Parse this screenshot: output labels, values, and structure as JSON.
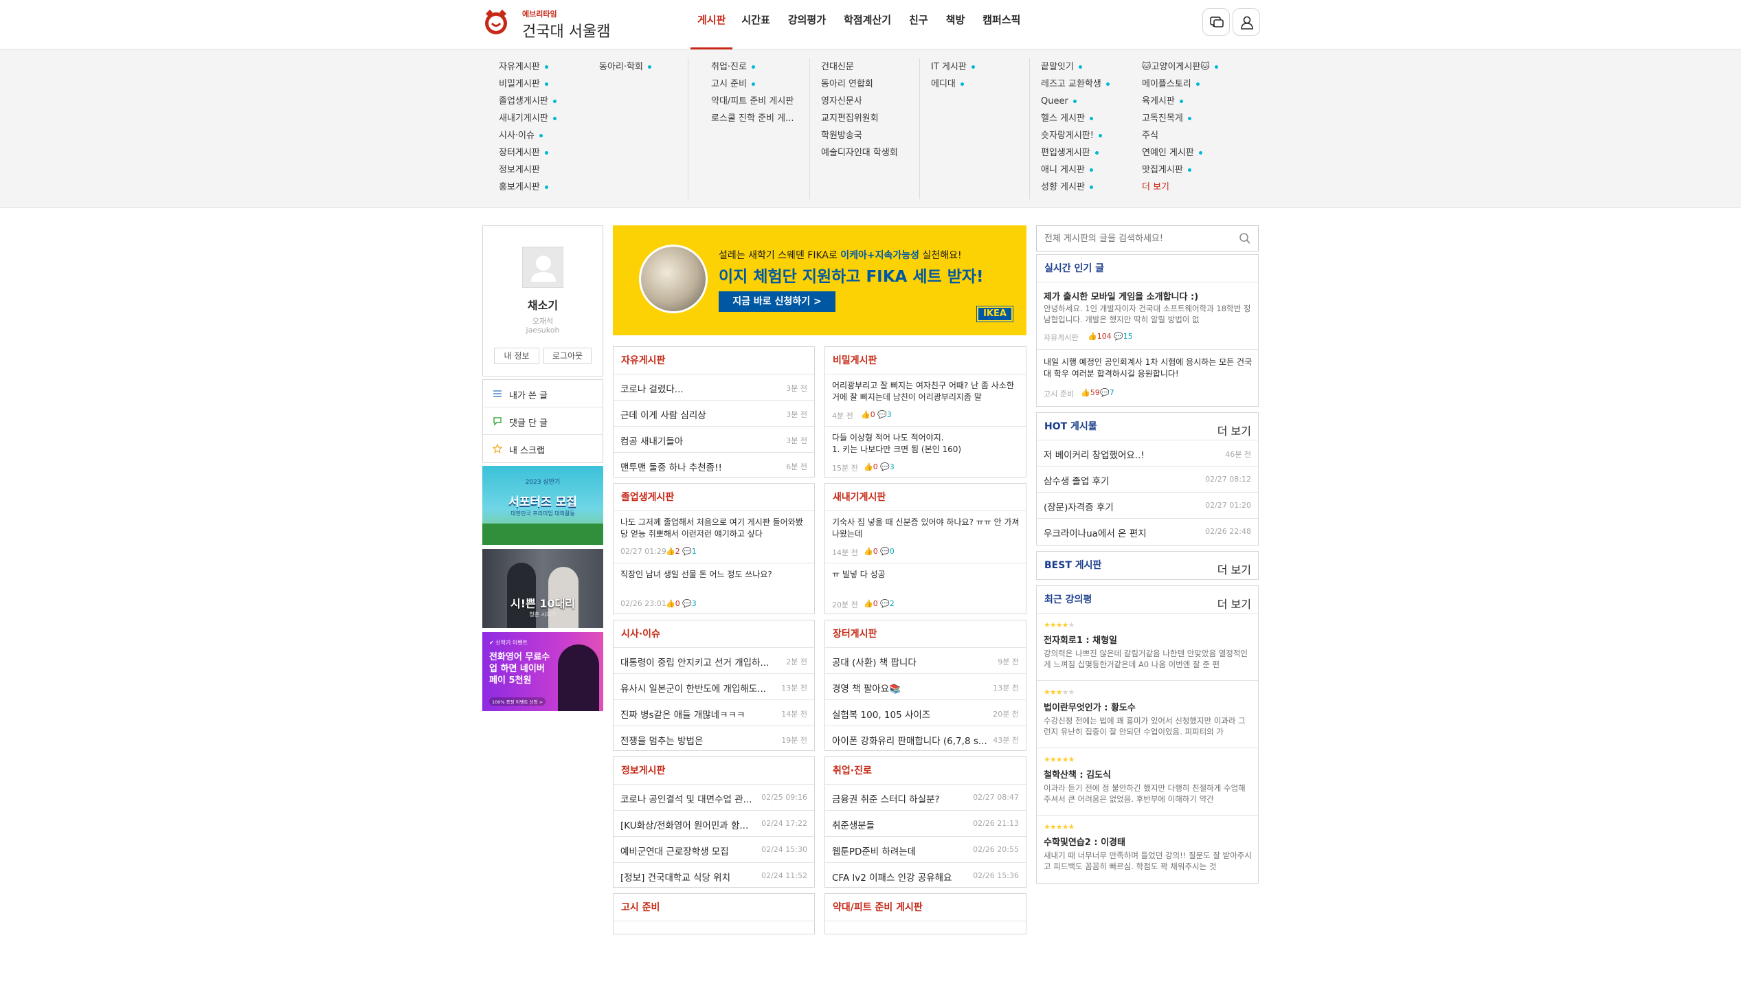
{
  "brand": {
    "sub": "에브리타임",
    "name": "건국대 서울캠"
  },
  "nav": [
    {
      "label": "게시판",
      "active": true
    },
    {
      "label": "시간표"
    },
    {
      "label": "강의평가"
    },
    {
      "label": "학점계산기"
    },
    {
      "label": "친구"
    },
    {
      "label": "책방"
    },
    {
      "label": "캠퍼스픽"
    }
  ],
  "megamenu": {
    "columns": [
      {
        "items": [
          {
            "label": "자유게시판",
            "dot": true
          },
          {
            "label": "비밀게시판",
            "dot": true
          },
          {
            "label": "졸업생게시판",
            "dot": true
          },
          {
            "label": "새내기게시판",
            "dot": true
          },
          {
            "label": "시사·이슈",
            "dot": true
          },
          {
            "label": "장터게시판",
            "dot": true
          },
          {
            "label": "정보게시판"
          },
          {
            "label": "홍보게시판",
            "dot": true
          }
        ]
      },
      {
        "items": [
          {
            "label": "동아리·학회",
            "dot": true
          }
        ]
      },
      {
        "items": [
          {
            "label": "취업·진로",
            "dot": true
          },
          {
            "label": "고시 준비",
            "dot": true
          },
          {
            "label": "약대/피트 준비 게시판"
          },
          {
            "label": "로스쿨 진학 준비 게..."
          }
        ]
      },
      {
        "items": [
          {
            "label": "건대신문"
          },
          {
            "label": "동아리 연합회"
          },
          {
            "label": "영자신문사"
          },
          {
            "label": "교지편집위원회"
          },
          {
            "label": "학원방송국"
          },
          {
            "label": "예술디자인대 학생회"
          }
        ]
      },
      {
        "items": [
          {
            "label": "IT 게시판",
            "dot": true
          },
          {
            "label": "에디대",
            "dot": true
          }
        ]
      },
      {
        "items": [
          {
            "label": "끝말잇기",
            "dot": true
          },
          {
            "label": "레즈고 교환학생",
            "dot": true
          },
          {
            "label": "Queer",
            "dot": true
          },
          {
            "label": "헬스 게시판",
            "dot": true
          },
          {
            "label": "숏자랑게시판!",
            "dot": true
          },
          {
            "label": "편입생게시판",
            "dot": true
          },
          {
            "label": "애니 게시판",
            "dot": true
          },
          {
            "label": "성향 게시판",
            "dot": true
          }
        ]
      },
      {
        "items": [
          {
            "label": "🐱고양이게시판🐱",
            "dot": true
          },
          {
            "label": "메이플스토리",
            "dot": true
          },
          {
            "label": "육게시판",
            "dot": true
          },
          {
            "label": "고독진목게",
            "dot": true
          },
          {
            "label": "주식"
          },
          {
            "label": "연예인 게시판",
            "dot": true
          },
          {
            "label": "맛집게시판",
            "dot": true
          },
          {
            "label": "더 보기",
            "more": true
          }
        ]
      }
    ]
  },
  "profile": {
    "name": "채소기",
    "realname": "오재석",
    "userid": "jaesukoh",
    "btn_info": "내 정보",
    "btn_logout": "로그아웃",
    "menu": [
      {
        "label": "내가 쓴 글",
        "icon": "list-icon"
      },
      {
        "label": "댓글 단 글",
        "icon": "comment-icon"
      },
      {
        "label": "내 스크랩",
        "icon": "star-icon"
      }
    ]
  },
  "side_ads": [
    {
      "badge": "2023 상반기",
      "title": "서포터즈 모집",
      "tail": "대한민국 프리미엄 대외활동"
    },
    {
      "title": "시!쁜 10대리",
      "tail": "청춘 시리즈"
    },
    {
      "badge": "✔ 신학기 이벤트",
      "title": "전화영어 무료수업 하면 네이버페이 5천원",
      "tail": "100% 증정 이벤트 신청 >"
    }
  ],
  "banner": {
    "line1_prefix": "설레는 새학기 스웨덴 FIKA로 ",
    "line1_hl": "이케아+지속가능성",
    "line1_suffix": " 실천해요!",
    "line2": "이지 체험단 지원하고 FIKA 세트 받자!",
    "cta": "지금 바로 신청하기 >",
    "logo": "IKEA"
  },
  "boards": [
    {
      "title": "자유게시판",
      "type": "list",
      "posts": [
        {
          "title": "코로나 걸렸다...",
          "time": "3분 전"
        },
        {
          "title": "근데 이게 사람 심리상",
          "time": "3분 전"
        },
        {
          "title": "컴공 새내기들아",
          "time": "3분 전"
        },
        {
          "title": "맨투맨 둘중 하나 추천좀!!",
          "time": "6분 전"
        }
      ]
    },
    {
      "title": "비밀게시판",
      "type": "preview",
      "posts": [
        {
          "body": "어리광부리고 잘 삐지는 여자친구 어때? 난 좀 사소한거에 잘 삐지는데 남친이 어리광부리지좀 말",
          "time": "4분 전",
          "votes": "0",
          "comments": "3"
        },
        {
          "body": "다들 이상형 적어 나도 적어야지.\n1. 키는 나보다만 크면 됨 (본인 160)",
          "time": "15분 전",
          "votes": "0",
          "comments": "3"
        }
      ]
    },
    {
      "title": "졸업생게시판",
      "type": "preview",
      "posts": [
        {
          "body": "나도 그저께 졸업해서 처음으로 여기 게시판 들어와봤당 얻능 취뽀해서 이런저런 얘기하고 싶다",
          "time": "02/27 01:29",
          "votes": "2",
          "comments": "1"
        },
        {
          "body": "직장인 남녀 생일 선물 돈 어느 정도 쓰나요?",
          "time": "02/26 23:01",
          "votes": "0",
          "comments": "3"
        }
      ]
    },
    {
      "title": "새내기게시판",
      "type": "preview",
      "posts": [
        {
          "body": "기숙사 짐 넣을 때 신분증 있어야 하나요? ㅠㅠ 안 가져 나왔는데",
          "time": "14분 전",
          "votes": "0",
          "comments": "0"
        },
        {
          "body": "ㅠ 빌넣 다 성공",
          "time": "20분 전",
          "votes": "0",
          "comments": "2"
        }
      ]
    },
    {
      "title": "시사·이슈",
      "type": "list",
      "posts": [
        {
          "title": "대통령이 중립 안지키고 선거 개입하...",
          "time": "2분 전"
        },
        {
          "title": "유사시 일본군이 한반도에 개입해도...",
          "time": "13분 전"
        },
        {
          "title": "진짜 병s같은 애들 개많네ㅋㅋㅋ",
          "time": "14분 전"
        },
        {
          "title": "전쟁을 멈추는 방법은",
          "time": "19분 전"
        }
      ]
    },
    {
      "title": "장터게시판",
      "type": "list",
      "posts": [
        {
          "title": "공대 (사환) 책 팝니다",
          "time": "9분 전"
        },
        {
          "title": "경영 책 팔아요📚",
          "time": "13분 전"
        },
        {
          "title": "실험복 100, 105 사이즈",
          "time": "20분 전"
        },
        {
          "title": "아이폰 강화유리 판매합니다 (6,7,8 s...",
          "time": "43분 전"
        }
      ]
    },
    {
      "title": "정보게시판",
      "type": "list",
      "posts": [
        {
          "title": "코로나 공인결석 및 대면수업 관...",
          "time": "02/25 09:16"
        },
        {
          "title": "[KU화상/전화영어 원어민과 함...",
          "time": "02/24 17:22"
        },
        {
          "title": "예비군연대 근로장학생 모집",
          "time": "02/24 15:30"
        },
        {
          "title": "[정보] 건국대학교 식당 위치",
          "time": "02/24 11:52"
        }
      ]
    },
    {
      "title": "취업·진로",
      "type": "list",
      "posts": [
        {
          "title": "금융권 취준 스터디 하실분?",
          "time": "02/27 08:47"
        },
        {
          "title": "취준생분들",
          "time": "02/26 21:13"
        },
        {
          "title": "웹툰PD준비 하려는데",
          "time": "02/26 20:55"
        },
        {
          "title": "CFA lv2 이패스 인강 공유해요",
          "time": "02/26 15:36"
        }
      ]
    }
  ],
  "more_boards": [
    "고시 준비",
    "약대/피트 준비 게시판"
  ],
  "search": {
    "placeholder": "전체 게시판의 글을 검색하세요!"
  },
  "realtime": {
    "title": "실시간 인기 글",
    "posts": [
      {
        "title": "제가 출시한 모바일 게임을 소개합니다 :)",
        "body": "안녕하세요. 1인 개발자이자 건국대 소프트웨어학과 18학번 정남협입니다. 개발은 했지만 딱히 알릴 방법이 없",
        "board": "자유게시판",
        "votes": "104",
        "comments": "15"
      },
      {
        "title": "",
        "body": "내일 시행 예정인 공인회계사 1차 시험에 응시하는 모든 건국대 학우 여러분 합격하시길 응원합니다!",
        "board": "고시 준비",
        "votes": "59",
        "comments": "7"
      }
    ]
  },
  "hot": {
    "title": "HOT 게시물",
    "more": "더 보기",
    "posts": [
      {
        "title": "저 베이커리 창업했어요..!",
        "time": "46분 전"
      },
      {
        "title": "삼수생 졸업 후기",
        "time": "02/27 08:12"
      },
      {
        "title": "(장문)자격증 후기",
        "time": "02/27 01:20"
      },
      {
        "title": "우크라이나ua에서 온 편지",
        "time": "02/26 22:48"
      }
    ]
  },
  "best": {
    "title": "BEST 게시판",
    "more": "더 보기"
  },
  "reviews": {
    "title": "최근 강의평",
    "more": "더 보기",
    "items": [
      {
        "rating": 4,
        "course": "전자회로1 : 채형일",
        "text": "강의력은 나쁘진 않은데 갈림거같음 나한텐 안맞았음 열정적인게 느껴짐 십몇등한거같은데 A0 나옴 이번엔 잘 준 편"
      },
      {
        "rating": 3,
        "course": "법이란무엇인가 : 황도수",
        "text": "수강신청 전에는 법에 꽤 흥미가 있어서 신청했지만 이과라 그런지 유난히 집중이 잘 안되던 수업이었음. 피피티의 가"
      },
      {
        "rating": 5,
        "course": "철학산책 : 김도식",
        "text": "이과라 듣기 전에 정 불안하긴 했지만 다행히 친절하게 수업해주셔서 큰 어려움은 없었음. 후반부에 이해하기 약간"
      },
      {
        "rating": 5,
        "course": "수학및연습2 : 이경태",
        "text": "새내기 때 너무너무 만족하며 들었던 강의!! 질문도 잘 받아주시고 피드백도 꼼꼼히 빠르심. 학점도 꽉 채워주시는 것"
      }
    ]
  },
  "colors": {
    "brand": "#c62917",
    "accent_blue": "#1a3e8c",
    "comment": "#00a9c1",
    "star": "#ffcd33"
  }
}
